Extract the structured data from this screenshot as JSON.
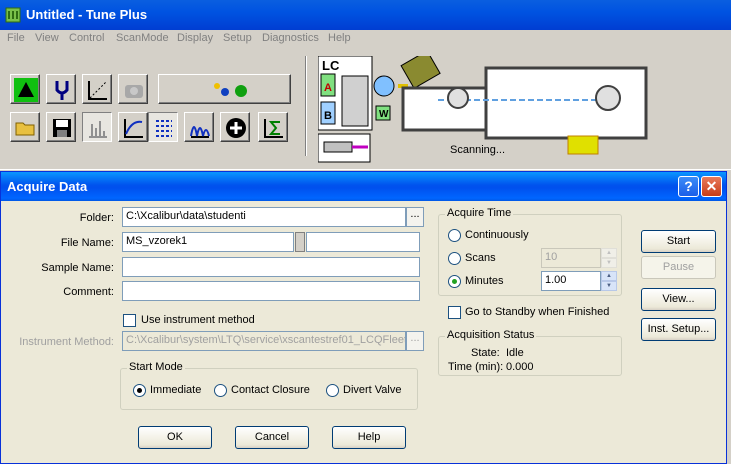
{
  "main_window": {
    "title": "Untitled - Tune Plus",
    "menu": [
      "File",
      "View",
      "Control",
      "ScanMode",
      "Display",
      "Setup",
      "Diagnostics",
      "Help"
    ],
    "instrument_labels": {
      "lc": "LC",
      "a": "A",
      "b": "B",
      "w": "W"
    },
    "status": "Scanning..."
  },
  "dialog": {
    "title": "Acquire Data",
    "folder_label": "Folder:",
    "folder_value": "C:\\Xcalibur\\data\\studenti",
    "file_name_label": "File Name:",
    "file_name_value": "MS_vzorek1",
    "sample_name_label": "Sample Name:",
    "sample_name_value": "",
    "comment_label": "Comment:",
    "comment_value": "",
    "browse_label": "...",
    "use_instrument_method_label": "Use instrument method",
    "instrument_method_label": "Instrument Method:",
    "instrument_method_value": "C:\\Xcalibur\\system\\LTQ\\service\\xscantestref01_LCQFleet",
    "start_mode": {
      "title": "Start Mode",
      "options": [
        "Immediate",
        "Contact Closure",
        "Divert Valve"
      ],
      "selected": "Immediate"
    },
    "acquire_time": {
      "title": "Acquire Time",
      "continuously_label": "Continuously",
      "scans_label": "Scans",
      "scans_value": "10",
      "minutes_label": "Minutes",
      "minutes_value": "1.00",
      "selected": "Minutes"
    },
    "standby_label": "Go to Standby when Finished",
    "acquisition_status": {
      "title": "Acquisition Status",
      "state_label": "State:",
      "state_value": "Idle",
      "time_label": "Time (min):",
      "time_value": "0.000"
    },
    "buttons": {
      "start": "Start",
      "pause": "Pause",
      "view": "View...",
      "inst_setup": "Inst. Setup...",
      "ok": "OK",
      "cancel": "Cancel",
      "help": "Help"
    },
    "caption": {
      "help": "?",
      "close": "✕"
    }
  },
  "colors": {
    "xp_blue": "#0053e1",
    "dialog_bg": "#ece9d8",
    "radio_dot": "#21a121"
  }
}
